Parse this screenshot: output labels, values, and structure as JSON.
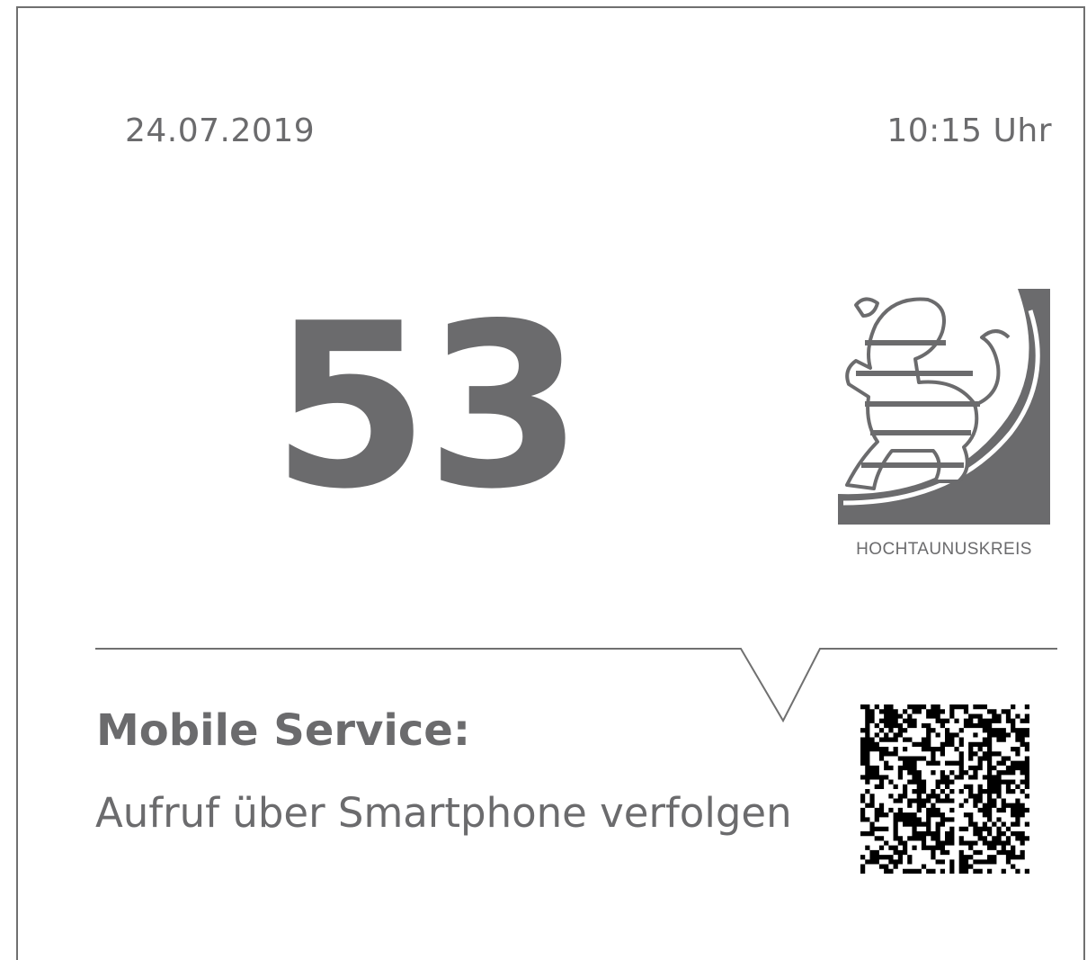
{
  "header": {
    "date": "24.07.2019",
    "time": "10:15 Uhr"
  },
  "ticket": {
    "number": "53"
  },
  "logo": {
    "caption": "HOCHTAUNUSKREIS",
    "icon": "hessian-lion-coat-of-arms"
  },
  "mobile_service": {
    "title": "Mobile Service:",
    "description": "Aufruf über Smartphone verfolgen",
    "qr_icon": "qr-code"
  },
  "colors": {
    "text": "#6b6b6d",
    "border": "#707070",
    "background": "#ffffff"
  }
}
